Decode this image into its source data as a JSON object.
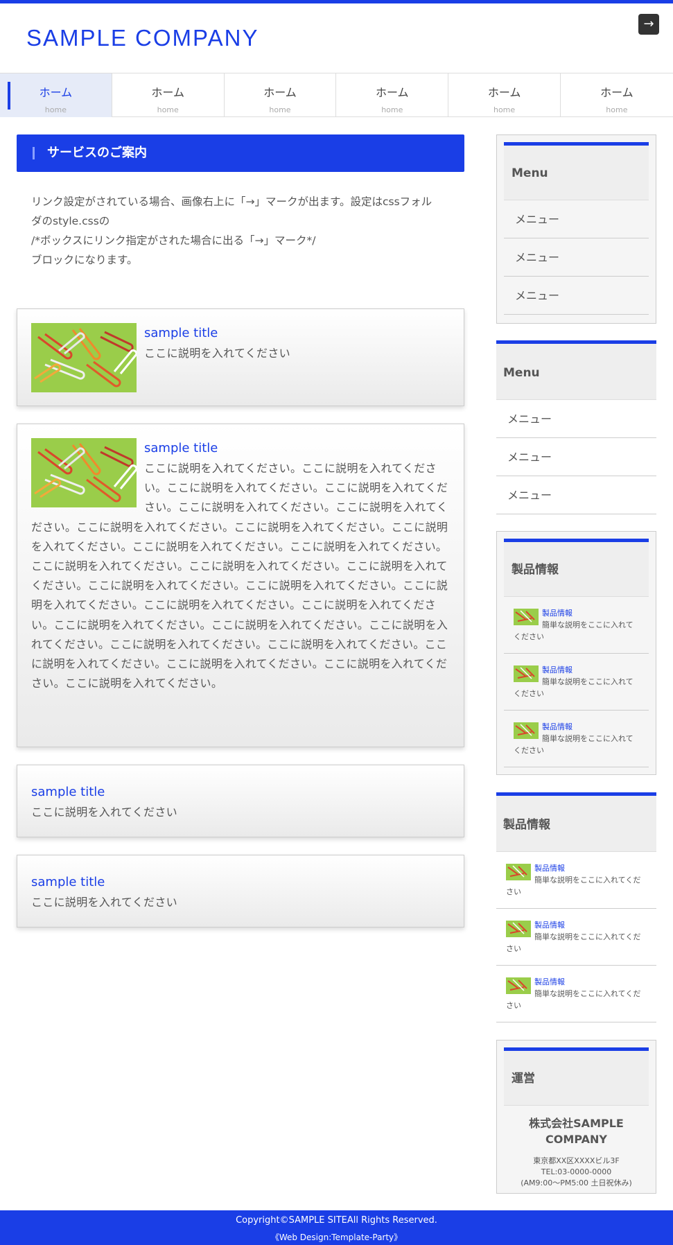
{
  "header": {
    "logo": "SAMPLE COMPANY",
    "menu_button": "→"
  },
  "nav": [
    {
      "label": "ホーム",
      "sub": "home"
    },
    {
      "label": "ホーム",
      "sub": "home"
    },
    {
      "label": "ホーム",
      "sub": "home"
    },
    {
      "label": "ホーム",
      "sub": "home"
    },
    {
      "label": "ホーム",
      "sub": "home"
    },
    {
      "label": "ホーム",
      "sub": "home"
    }
  ],
  "main": {
    "heading": "サービスのご案内",
    "intro": [
      "リンク設定がされている場合、画像右上に「→」マークが出ます。設定はcssフォル",
      "ダのstyle.cssの",
      "/*ボックスにリンク指定がされた場合に出る「→」マーク*/",
      "ブロックになります。"
    ],
    "boxes": [
      {
        "title": "sample title",
        "text": "ここに説明を入れてください"
      },
      {
        "title": "sample title",
        "text": "ここに説明を入れてください。ここに説明を入れてください。ここに説明を入れてください。ここに説明を入れてください。ここに説明を入れてください。ここに説明を入れてください。ここに説明を入れてください。ここに説明を入れてください。ここに説明を入れてください。ここに説明を入れてください。ここに説明を入れてください。ここに説明を入れてください。ここに説明を入れてください。ここに説明を入れてください。ここに説明を入れてください。ここに説明を入れてください。ここに説明を入れてください。ここに説明を入れてください。ここに説明を入れてください。ここに説明を入れてください。ここに説明を入れてください。ここに説明を入れてください。ここに説明を入れてください。ここに説明を入れてください。ここに説明を入れてください。ここに説明を入れてください。ここに説明を入れてください。ここに説明を入れてください。"
      },
      {
        "title": "sample title",
        "text": "ここに説明を入れてください"
      },
      {
        "title": "sample title",
        "text": "ここに説明を入れてください"
      }
    ]
  },
  "sidebar": {
    "menu1": {
      "title": "Menu",
      "items": [
        "メニュー",
        "メニュー",
        "メニュー"
      ]
    },
    "menu2": {
      "title": "Menu",
      "items": [
        "メニュー",
        "メニュー",
        "メニュー"
      ]
    },
    "products1": {
      "title": "製品情報",
      "items": [
        {
          "link": "製品情報",
          "desc": "簡単な説明をここに入れてください"
        },
        {
          "link": "製品情報",
          "desc": "簡単な説明をここに入れてください"
        },
        {
          "link": "製品情報",
          "desc": "簡単な説明をここに入れてください"
        }
      ]
    },
    "products2": {
      "title": "製品情報",
      "items": [
        {
          "link": "製品情報",
          "desc": "簡単な説明をここに入れてください"
        },
        {
          "link": "製品情報",
          "desc": "簡単な説明をここに入れてください"
        },
        {
          "link": "製品情報",
          "desc": "簡単な説明をここに入れてください"
        }
      ]
    },
    "org": {
      "title": "運営",
      "name1": "株式会社SAMPLE",
      "name2": "COMPANY",
      "addr": "東京都XX区XXXXビル3F",
      "tel": "TEL:03-0000-0000",
      "hours": "(AM9:00〜PM5:00 土日祝休み)"
    }
  },
  "footer": {
    "copyright": "Copyright©SAMPLE SITEAll Rights Reserved.",
    "design": "《Web Design:Template-Party》"
  },
  "colors": {
    "accent": "#1a3ee6"
  }
}
